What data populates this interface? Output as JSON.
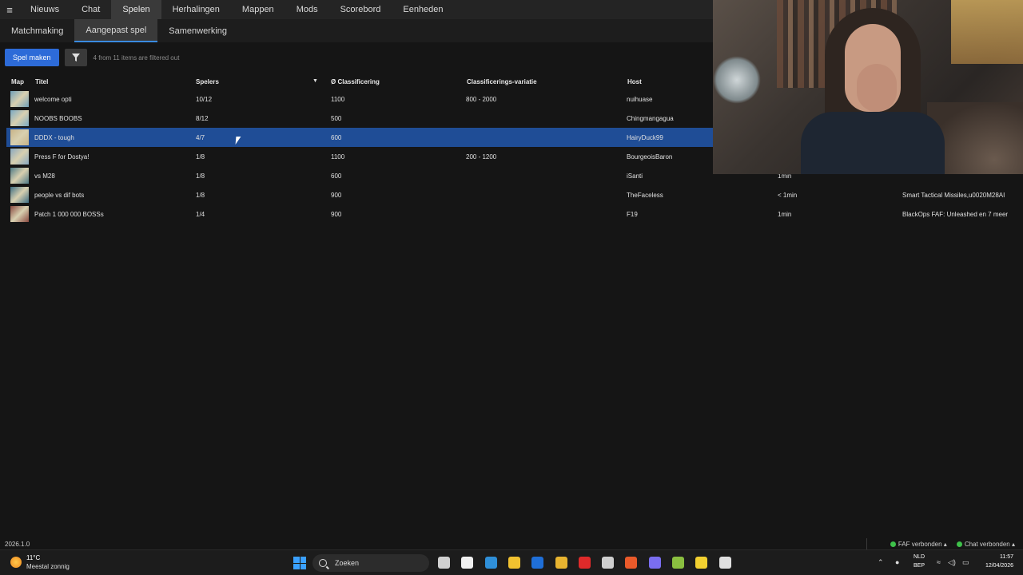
{
  "topnav": {
    "tabs": [
      "Nieuws",
      "Chat",
      "Spelen",
      "Herhalingen",
      "Mappen",
      "Mods",
      "Scorebord",
      "Eenheden"
    ],
    "active_index": 2
  },
  "subnav": {
    "tabs": [
      "Matchmaking",
      "Aangepast spel",
      "Samenwerking"
    ],
    "active_index": 1
  },
  "toolbar": {
    "create_label": "Spel maken",
    "filter_status": "4 from 11 items are filtered out"
  },
  "table": {
    "headers": {
      "map": "Map",
      "title": "Titel",
      "players": "Spelers",
      "rating": "Ø Classificering",
      "range": "Classificerings-variatie",
      "host": "Host"
    },
    "rows": [
      {
        "title": "welcome opti",
        "players": "10/12",
        "rating": "1100",
        "range": "800 - 2000",
        "host": "nuihuase",
        "time": "",
        "mods": "",
        "thumb_color": "#6f9fb8"
      },
      {
        "title": "NOOBS BOOBS",
        "players": "8/12",
        "rating": "500",
        "range": "",
        "host": "Chingmangagua",
        "time": "",
        "mods": "",
        "thumb_color": "#7aaac4"
      },
      {
        "title": "DDDX - tough",
        "players": "4/7",
        "rating": "600",
        "range": "",
        "host": "HairyDuck99",
        "time": "",
        "mods": "",
        "thumb_color": "#c8b488",
        "selected": true
      },
      {
        "title": "Press F for Dostya!",
        "players": "1/8",
        "rating": "1100",
        "range": "200 - 1200",
        "host": "BourgeoisBaron",
        "time": "",
        "mods": "",
        "thumb_color": "#88a8c0"
      },
      {
        "title": "vs M28",
        "players": "1/8",
        "rating": "600",
        "range": "",
        "host": "iSanti",
        "time": "1min",
        "mods": "",
        "thumb_color": "#4e7a86"
      },
      {
        "title": "people vs dif bots",
        "players": "1/8",
        "rating": "900",
        "range": "",
        "host": "TheFaceless",
        "time": "< 1min",
        "mods": "Smart Tactical Missiles,u0020M28AI",
        "thumb_color": "#3e6e84"
      },
      {
        "title": "Patch 1 000 000 BOSSs",
        "players": "1/4",
        "rating": "900",
        "range": "",
        "host": "F19",
        "time": "1min",
        "mods": "BlackOps FAF: Unleashed en 7 meer",
        "thumb_color": "#8a4a40"
      }
    ]
  },
  "footer": {
    "version": "2026.1.0",
    "faf_status": "FAF verbonden",
    "chat_status": "Chat verbonden",
    "status_color": "#3ec14a"
  },
  "taskbar": {
    "temperature": "11°C",
    "weather": "Meestal zonnig",
    "search_label": "Zoeken",
    "lang_line1": "NLD",
    "lang_line2": "BEP",
    "time": "11:57",
    "date": "12/04/2026",
    "icons": [
      "task-view-icon",
      "store-icon",
      "edge-icon",
      "file-explorer-icon",
      "outlook-icon",
      "chrome-icon",
      "youtube-icon",
      "calculator-icon",
      "brave-icon",
      "discord-icon",
      "game-icon",
      "norton-icon",
      "faf-icon"
    ]
  }
}
